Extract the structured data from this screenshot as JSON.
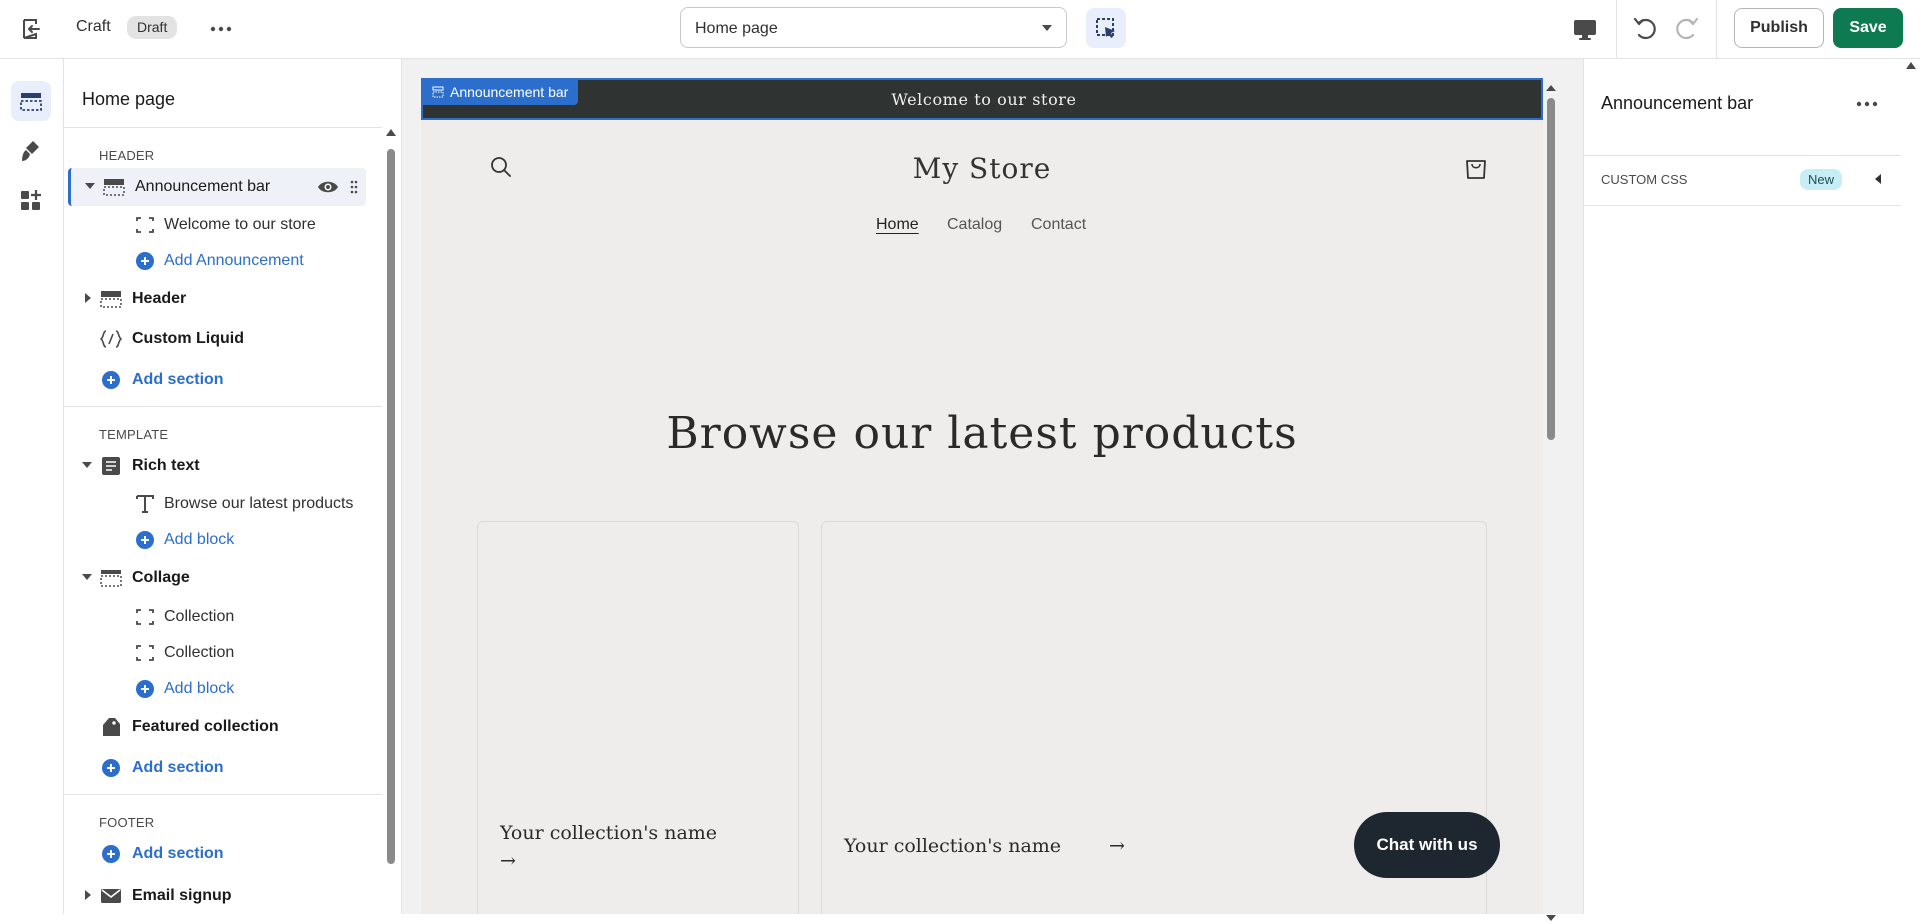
{
  "topbar": {
    "app_name": "Craft",
    "status_badge": "Draft",
    "page_select_value": "Home page",
    "publish_label": "Publish",
    "save_label": "Save"
  },
  "rail": {
    "items": [
      "sections-icon",
      "theme-settings-icon",
      "app-embeds-icon"
    ]
  },
  "sidebar": {
    "title": "Home page",
    "header_group": "HEADER",
    "header_rows": {
      "announcement_bar": "Announcement bar",
      "welcome": "Welcome to our store",
      "add_announcement": "Add Announcement",
      "header": "Header",
      "custom_liquid": "Custom Liquid",
      "add_section": "Add section"
    },
    "template_group": "TEMPLATE",
    "template_rows": {
      "rich_text": "Rich text",
      "browse": "Browse our latest products",
      "add_block_1": "Add block",
      "collage": "Collage",
      "collection_1": "Collection",
      "collection_2": "Collection",
      "add_block_2": "Add block",
      "featured_collection": "Featured collection",
      "add_section": "Add section"
    },
    "footer_group": "FOOTER",
    "footer_rows": {
      "add_section": "Add section",
      "email_signup": "Email signup"
    }
  },
  "preview": {
    "announcement_tag": "Announcement bar",
    "announcement_text": "Welcome to our store",
    "store_name": "My Store",
    "nav": [
      "Home",
      "Catalog",
      "Contact"
    ],
    "hero_title": "Browse our latest products",
    "collection_1": "Your collection's name",
    "collection_2": "Your collection's name",
    "arrow": "→",
    "chat_label": "Chat with us"
  },
  "right_panel": {
    "title": "Announcement bar",
    "custom_css_label": "CUSTOM CSS",
    "new_badge": "New"
  },
  "colors": {
    "accent": "#2c6ecb",
    "save": "#0d7a52",
    "announcement_bg": "#2f3432",
    "preview_bg": "#eeedeb",
    "chat_bg": "#1e2730",
    "new_badge_bg": "#c8eef5"
  }
}
